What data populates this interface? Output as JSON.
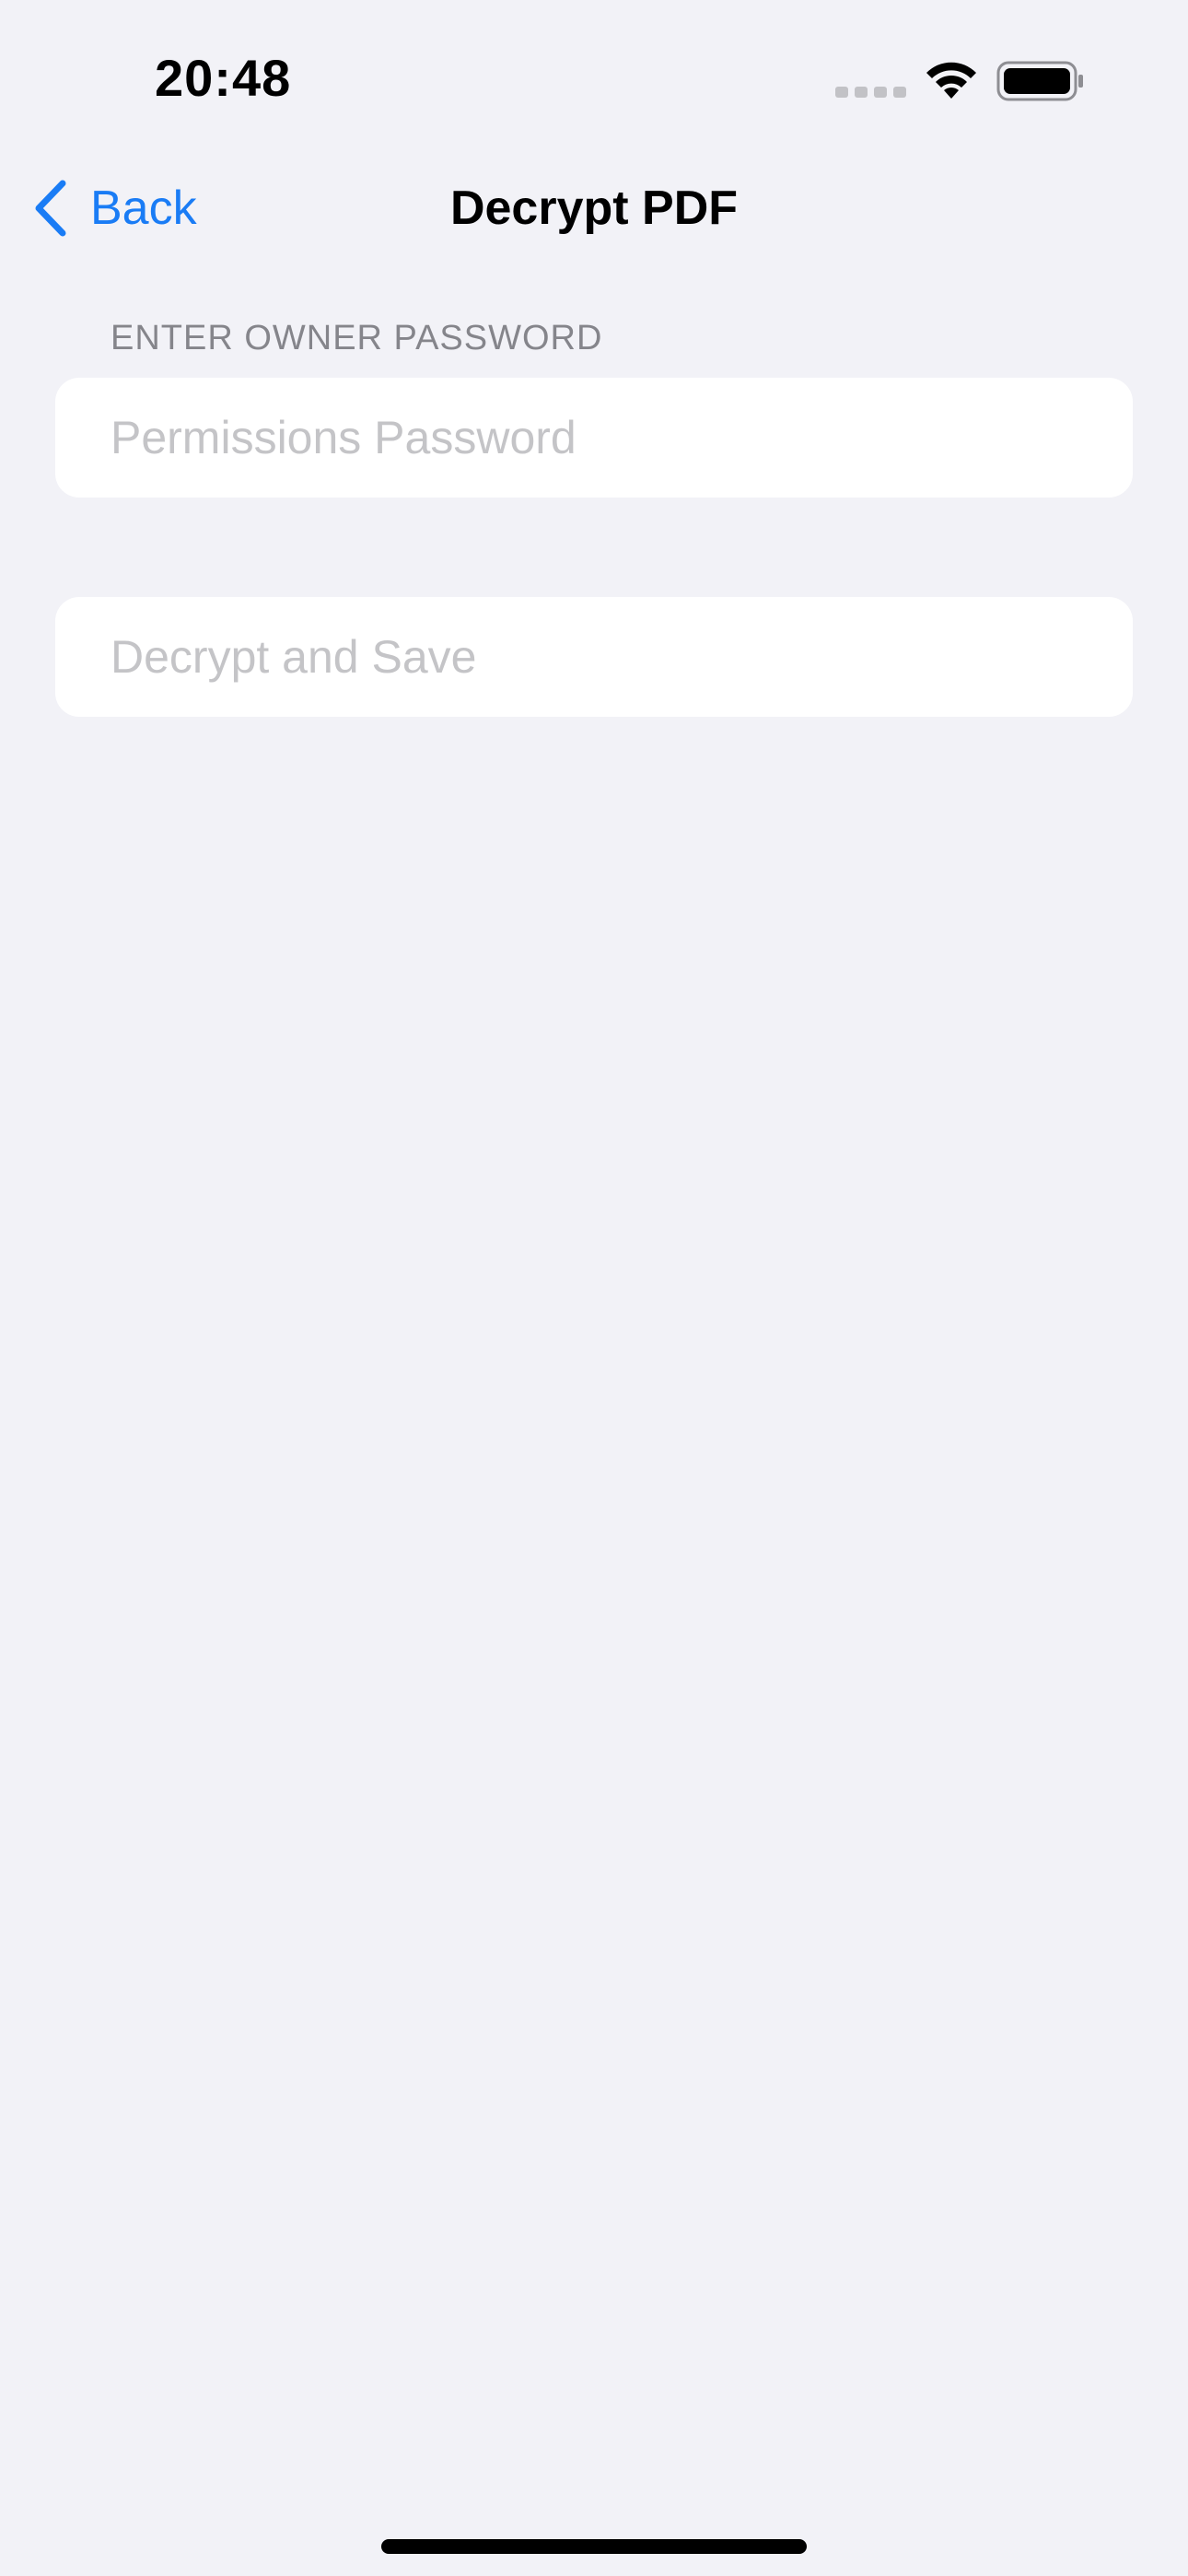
{
  "status_bar": {
    "time": "20:48",
    "icons": [
      "signal-dots-icon",
      "wifi-icon",
      "battery-icon"
    ]
  },
  "nav": {
    "back_label": "Back",
    "title": "Decrypt PDF",
    "accent_color": "#1a7cf5"
  },
  "form": {
    "section_header": "ENTER OWNER PASSWORD",
    "password_placeholder": "Permissions Password",
    "password_value": "",
    "action_label": "Decrypt and Save",
    "action_enabled": false
  },
  "colors": {
    "background": "#f2f2f7",
    "card": "#ffffff",
    "placeholder": "#c4c4c7",
    "section_header": "#85858b"
  }
}
